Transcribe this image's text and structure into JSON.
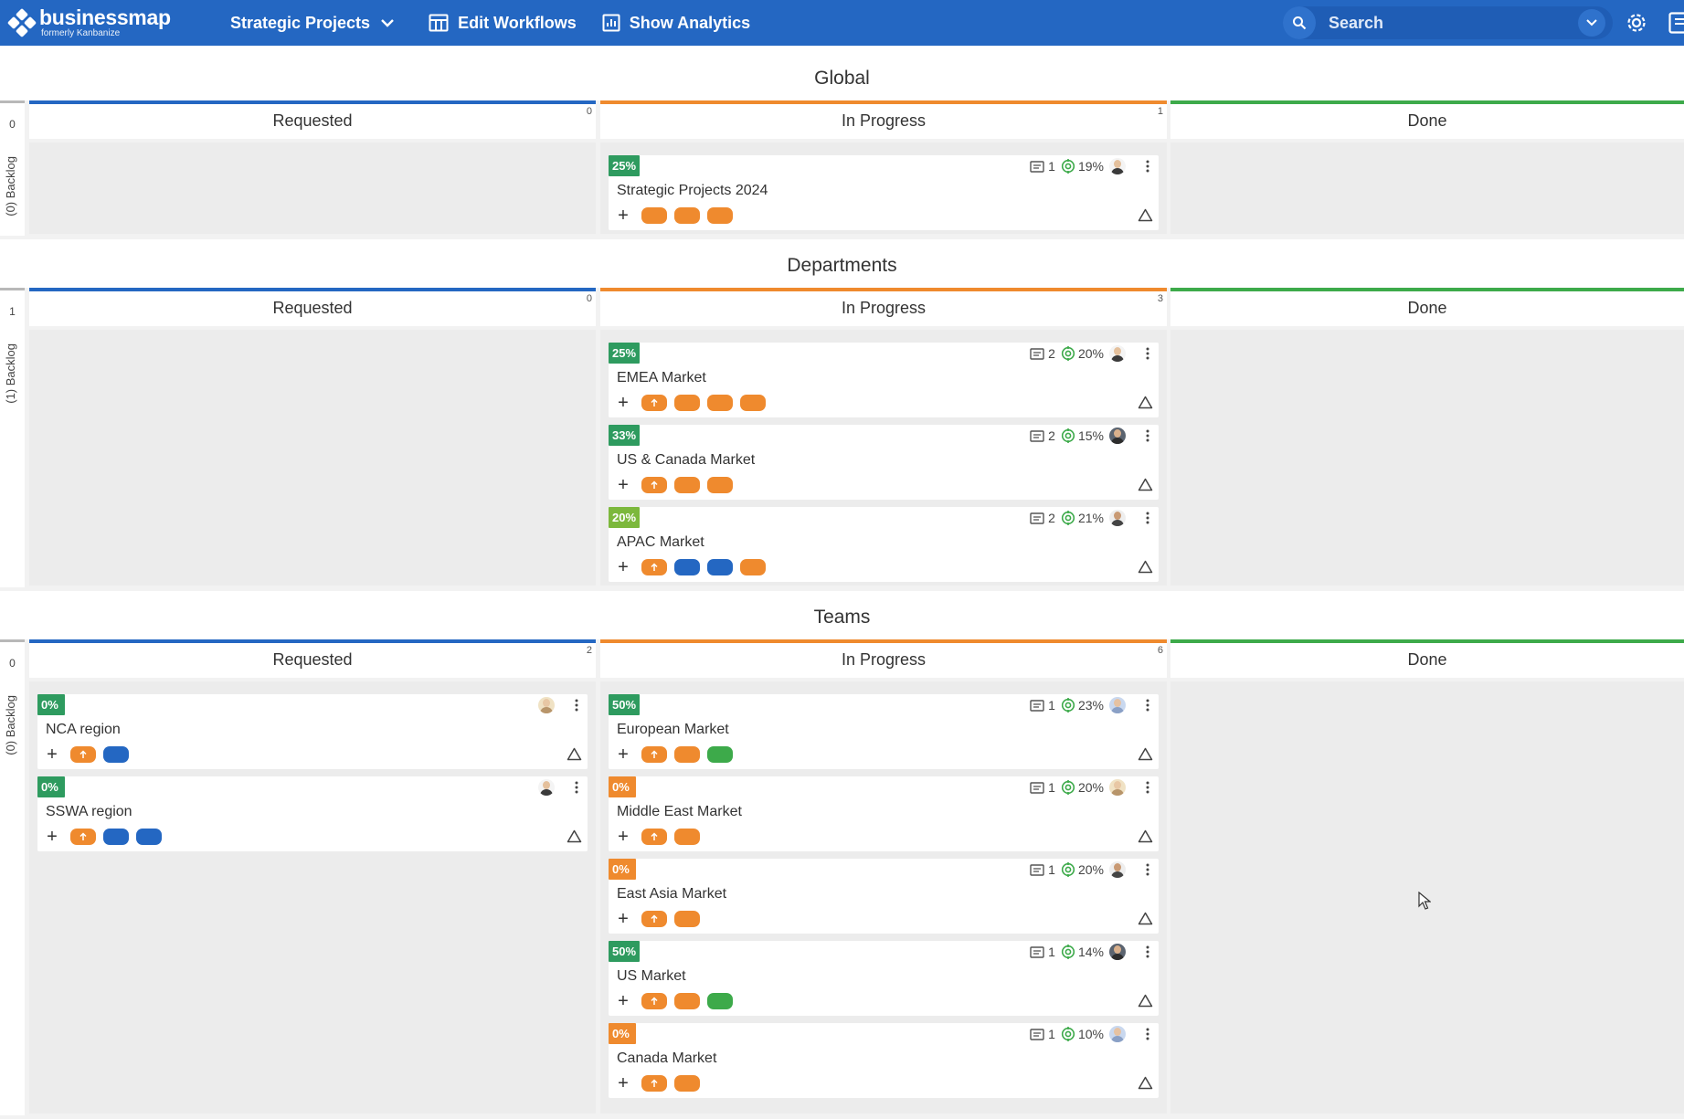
{
  "topbar": {
    "logo_name": "businessmap",
    "logo_sub": "formerly Kanbanize",
    "board_name": "Strategic Projects",
    "edit_workflows": "Edit Workflows",
    "show_analytics": "Show Analytics",
    "search_placeholder": "Search"
  },
  "colors": {
    "topbar": "#2467c2",
    "requested": "#2467c2",
    "in_progress": "#ef8a2e",
    "done": "#3daa4a",
    "tag_orange": "#ef8a2e",
    "tag_blue": "#2467c2",
    "tag_green": "#3daa4a",
    "pct_green": "#2e9b5f",
    "pct_lightgreen": "#7cb83c",
    "pct_orange": "#ef8a2e"
  },
  "lanes": [
    {
      "title": "Global",
      "side_count": "0",
      "side_label": "(0) Backlog",
      "columns": [
        {
          "name": "Requested",
          "count": "0",
          "cards": []
        },
        {
          "name": "In Progress",
          "count": "1",
          "cards": [
            {
              "pct": "25%",
              "pct_color": "green",
              "title": "Strategic Projects 2024",
              "comments": "1",
              "target": "19%",
              "avatar": "man-dark",
              "tags": [
                "orange",
                "orange",
                "orange"
              ]
            }
          ]
        },
        {
          "name": "Done",
          "count": "",
          "cards": []
        }
      ]
    },
    {
      "title": "Departments",
      "side_count": "1",
      "side_label": "(1) Backlog",
      "columns": [
        {
          "name": "Requested",
          "count": "0",
          "cards": []
        },
        {
          "name": "In Progress",
          "count": "3",
          "cards": [
            {
              "pct": "25%",
              "pct_color": "green",
              "title": "EMEA Market",
              "comments": "2",
              "target": "20%",
              "avatar": "man-dark",
              "tags": [
                "orange-up",
                "orange",
                "orange",
                "orange"
              ]
            },
            {
              "pct": "33%",
              "pct_color": "green",
              "title": "US & Canada Market",
              "comments": "2",
              "target": "15%",
              "avatar": "man-grey",
              "tags": [
                "orange-up",
                "orange",
                "orange"
              ]
            },
            {
              "pct": "20%",
              "pct_color": "lightgreen",
              "title": "APAC Market",
              "comments": "2",
              "target": "21%",
              "avatar": "man-beard",
              "tags": [
                "orange-up",
                "blue",
                "blue",
                "orange"
              ]
            }
          ]
        },
        {
          "name": "Done",
          "count": "",
          "cards": []
        }
      ]
    },
    {
      "title": "Teams",
      "side_count": "0",
      "side_label": "(0) Backlog",
      "columns": [
        {
          "name": "Requested",
          "count": "2",
          "cards": [
            {
              "pct": "0%",
              "pct_color": "green",
              "title": "NCA region",
              "comments": "",
              "target": "",
              "avatar": "woman-blonde",
              "tags": [
                "orange-up",
                "blue"
              ]
            },
            {
              "pct": "0%",
              "pct_color": "green",
              "title": "SSWA region",
              "comments": "",
              "target": "",
              "avatar": "man-dark",
              "tags": [
                "orange-up",
                "blue",
                "blue"
              ]
            }
          ]
        },
        {
          "name": "In Progress",
          "count": "6",
          "cards": [
            {
              "pct": "50%",
              "pct_color": "green",
              "title": "European Market",
              "comments": "1",
              "target": "23%",
              "avatar": "woman-blue",
              "tags": [
                "orange-up",
                "orange",
                "green"
              ]
            },
            {
              "pct": "0%",
              "pct_color": "orange",
              "title": "Middle East Market",
              "comments": "1",
              "target": "20%",
              "avatar": "woman-blonde",
              "tags": [
                "orange-up",
                "orange"
              ]
            },
            {
              "pct": "0%",
              "pct_color": "orange",
              "title": "East Asia Market",
              "comments": "1",
              "target": "20%",
              "avatar": "man-beard",
              "tags": [
                "orange-up",
                "orange"
              ]
            },
            {
              "pct": "50%",
              "pct_color": "green",
              "title": "US Market",
              "comments": "1",
              "target": "14%",
              "avatar": "man-grey",
              "tags": [
                "orange-up",
                "orange",
                "green"
              ]
            },
            {
              "pct": "0%",
              "pct_color": "orange",
              "title": "Canada Market",
              "comments": "1",
              "target": "10%",
              "avatar": "woman-blue",
              "tags": [
                "orange-up",
                "orange"
              ]
            }
          ]
        },
        {
          "name": "Done",
          "count": "",
          "cards": []
        }
      ]
    }
  ]
}
